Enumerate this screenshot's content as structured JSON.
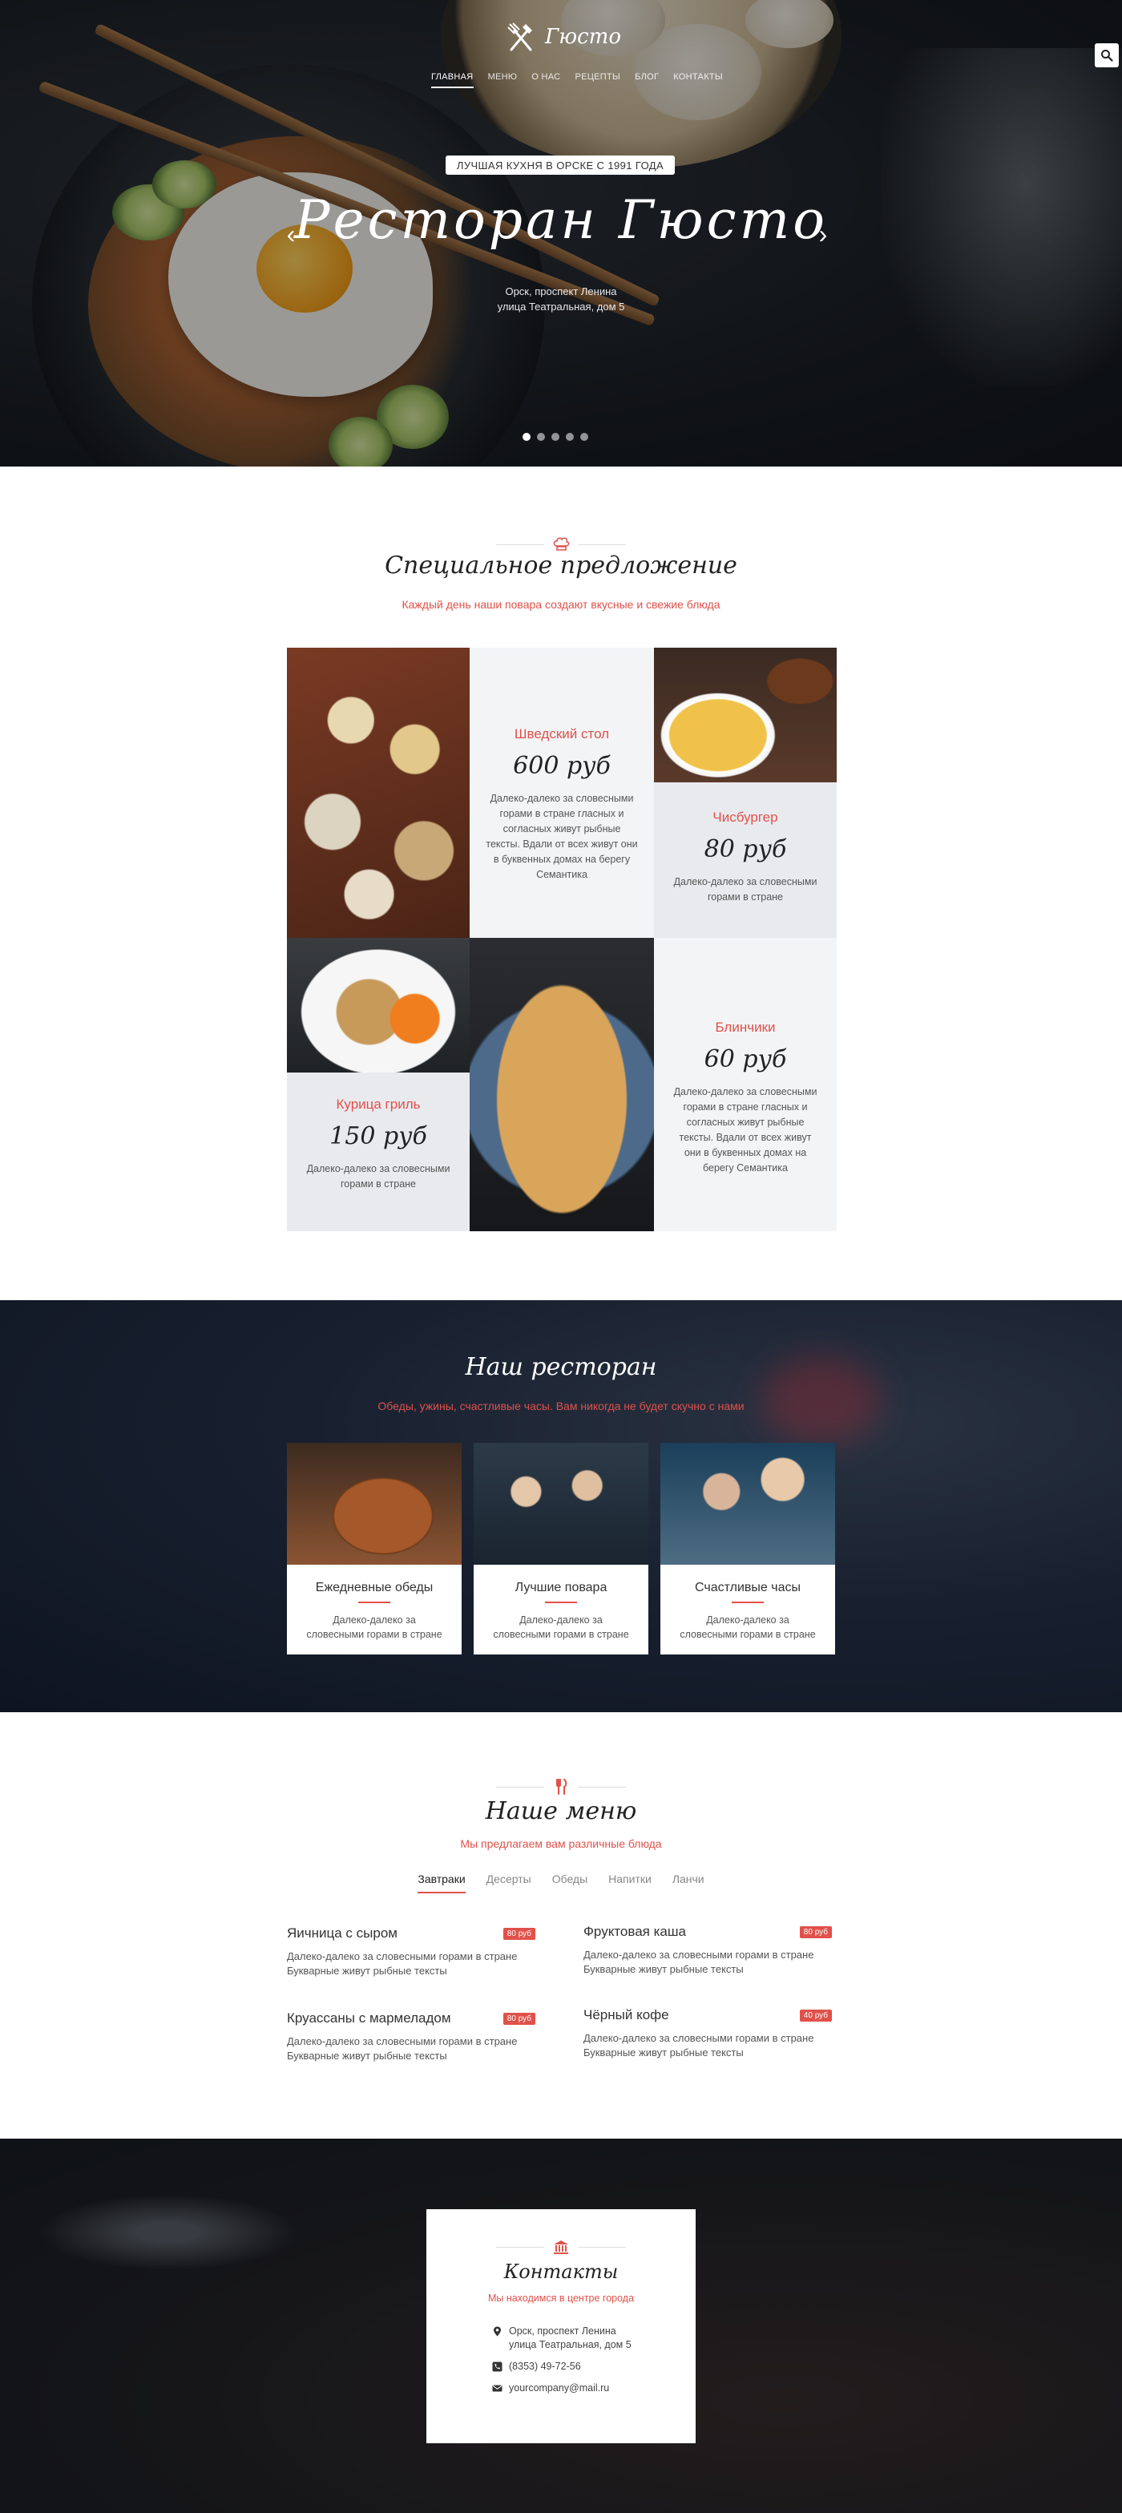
{
  "brand": {
    "name": "Гюсто",
    "accent": "#e0514a"
  },
  "nav": {
    "items": [
      "ГЛАВНАЯ",
      "МЕНЮ",
      "О НАС",
      "РЕЦЕПТЫ",
      "БЛОГ",
      "КОНТАКТЫ"
    ]
  },
  "hero": {
    "badge": "ЛУЧШАЯ КУХНЯ В ОРСКЕ С 1991 ГОДА",
    "title": "Ресторан Гюсто",
    "address_line1": "Орск, проспект Ленина",
    "address_line2": "улица Театральная, дом 5",
    "prev": "‹",
    "next": "›",
    "slides": 5,
    "active_slide": 1
  },
  "special": {
    "title": "Специальное предложение",
    "subtitle": "Каждый день наши повара создают вкусные и свежие блюда",
    "items": [
      {
        "name": "Шведский стол",
        "price": "600 руб",
        "desc": "Далеко-далеко за словесными горами в стране гласных и согласных живут рыбные тексты. Вдали от всех живут они в буквенных домах на берегу Семантика"
      },
      {
        "name": "Чисбургер",
        "price": "80 руб",
        "desc": "Далеко-далеко за словесными горами в стране"
      },
      {
        "name": "Курица гриль",
        "price": "150 руб",
        "desc": "Далеко-далеко за словесными горами в стране"
      },
      {
        "name": "Блинчики",
        "price": "60 руб",
        "desc": "Далеко-далеко за словесными горами в стране гласных и согласных живут рыбные тексты. Вдали от всех живут они в буквенных домах на берегу Семантика"
      }
    ]
  },
  "restaurant": {
    "title": "Наш ресторан",
    "subtitle": "Обеды, ужины, счастливые часы. Вам никогда не будет скучно с нами",
    "cards": [
      {
        "title": "Ежедневные обеды",
        "text": "Далеко-далеко за словесными горами в стране"
      },
      {
        "title": "Лучшие повара",
        "text": "Далеко-далеко за словесными горами в стране"
      },
      {
        "title": "Счастливые часы",
        "text": "Далеко-далеко за словесными горами в стране"
      }
    ]
  },
  "menu": {
    "title": "Наше меню",
    "subtitle": "Мы предлагаем вам различные блюда",
    "tabs": [
      "Завтраки",
      "Десерты",
      "Обеды",
      "Напитки",
      "Ланчи"
    ],
    "active_tab": "Завтраки",
    "items": [
      {
        "name": "Яичница с сыром",
        "price": "80 руб",
        "desc": "Далеко-далеко за словесными горами в стране Букварные живут рыбные тексты"
      },
      {
        "name": "Фруктовая каша",
        "price": "80 руб",
        "desc": "Далеко-далеко за словесными горами в стране Букварные живут рыбные тексты"
      },
      {
        "name": "Круассаны с мармеладом",
        "price": "80 руб",
        "desc": "Далеко-далеко за словесными горами в стране Букварные живут рыбные тексты"
      },
      {
        "name": "Чёрный кофе",
        "price": "40 руб",
        "desc": "Далеко-далеко за словесными горами в стране Букварные живут рыбные тексты"
      }
    ]
  },
  "contacts": {
    "title": "Контакты",
    "subtitle": "Мы находимся в центре города",
    "address_line1": "Орск, проспект Ленина",
    "address_line2": "улица Театральная, дом 5",
    "phone": "(8353) 49-72-56",
    "email": "yourcompany@mail.ru"
  },
  "icons": [
    "fork-knife-icon",
    "search-icon",
    "chef-hat-icon",
    "cutlery-icon",
    "bank-icon",
    "map-pin-icon",
    "phone-icon",
    "mail-icon"
  ]
}
